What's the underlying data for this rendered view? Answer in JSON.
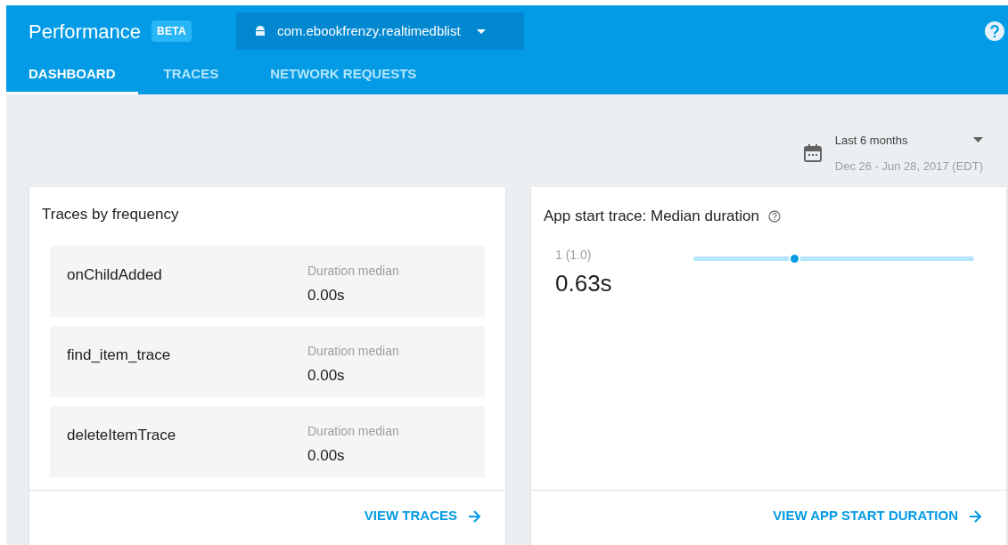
{
  "header": {
    "title": "Performance",
    "badge": "BETA",
    "app_selector": "com.ebookfrenzy.realtimedblist"
  },
  "tabs": [
    {
      "label": "DASHBOARD",
      "selected": true
    },
    {
      "label": "TRACES",
      "selected": false
    },
    {
      "label": "NETWORK REQUESTS",
      "selected": false
    }
  ],
  "date_range": {
    "label": "Last 6 months",
    "range": "Dec 26 - Jun 28, 2017 (EDT)"
  },
  "traces_card": {
    "title": "Traces by frequency",
    "rows": [
      {
        "name": "onChildAdded",
        "metric_label": "Duration median",
        "value": "0.00s"
      },
      {
        "name": "find_item_trace",
        "metric_label": "Duration median",
        "value": "0.00s"
      },
      {
        "name": "deleteItemTrace",
        "metric_label": "Duration median",
        "value": "0.00s"
      }
    ],
    "link": "VIEW TRACES"
  },
  "app_start_card": {
    "title": "App start trace: Median duration",
    "sample": "1 (1.0)",
    "value": "0.63s",
    "slider": {
      "level": 0.36
    },
    "link": "VIEW APP START DURATION"
  }
}
